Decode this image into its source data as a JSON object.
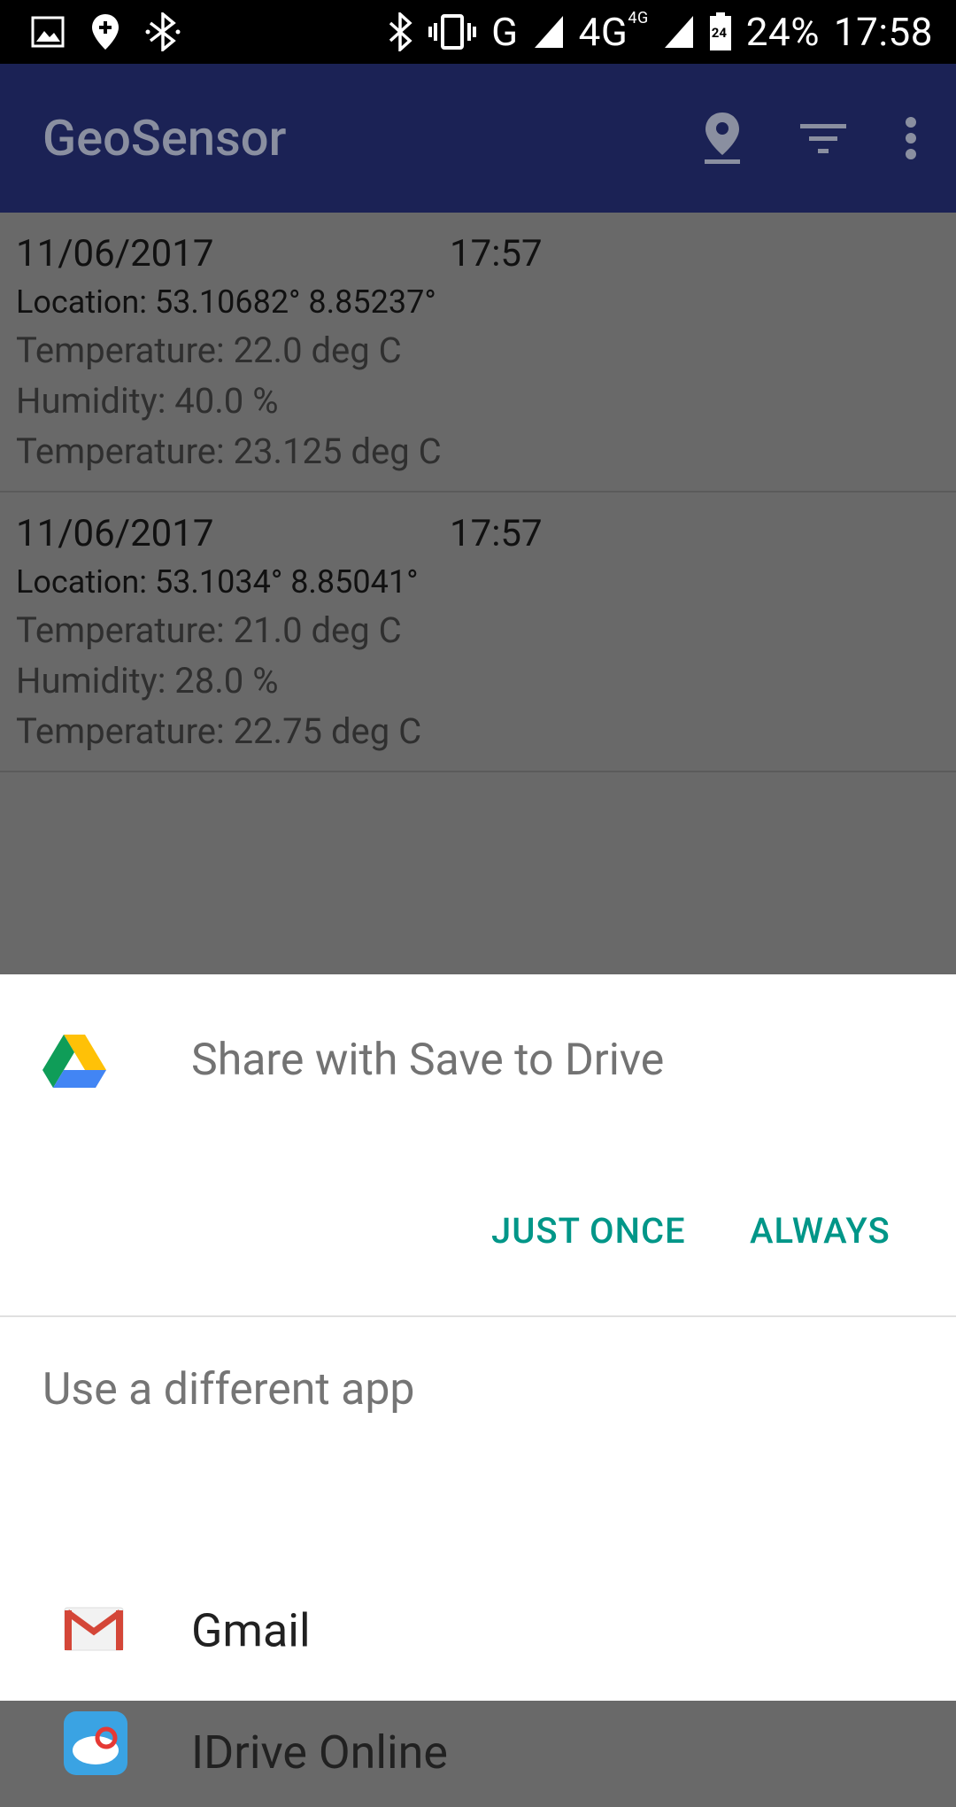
{
  "status_bar": {
    "network_g": "G",
    "network_4g": "4G",
    "network_4g_small": "4G",
    "battery_level": "24",
    "battery_percent": "24%",
    "time": "17:58",
    "icons": [
      "image-icon",
      "location-plus-icon",
      "bluetooth-icon",
      "bluetooth-icon",
      "vibrate-icon",
      "signal-icon",
      "battery-icon"
    ]
  },
  "app_bar": {
    "title": "GeoSensor",
    "actions": [
      "location-pin-icon",
      "filter-icon",
      "more-vert-icon"
    ]
  },
  "records": [
    {
      "date": "11/06/2017",
      "time": "17:57",
      "location": "Location: 53.10682° 8.85237°",
      "lines": [
        "Temperature: 22.0 deg C",
        "Humidity: 40.0 %",
        "Temperature: 23.125 deg C"
      ]
    },
    {
      "date": "11/06/2017",
      "time": "17:57",
      "location": "Location: 53.1034° 8.85041°",
      "lines": [
        "Temperature: 21.0 deg C",
        "Humidity: 28.0 %",
        "Temperature: 22.75 deg C"
      ]
    }
  ],
  "sheet": {
    "title": "Share with Save to Drive",
    "just_once": "JUST ONCE",
    "always": "ALWAYS",
    "section_label": "Use a different app",
    "apps": [
      {
        "label": "Gmail",
        "icon": "gmail-icon"
      },
      {
        "label": "IDrive Online",
        "icon": "idrive-icon"
      }
    ]
  },
  "colors": {
    "status_bar": "#000000",
    "app_bar_dimmed": "#1b2255",
    "scrim_background": "#696969",
    "accent": "#009688",
    "sheet_background": "#ffffff"
  }
}
